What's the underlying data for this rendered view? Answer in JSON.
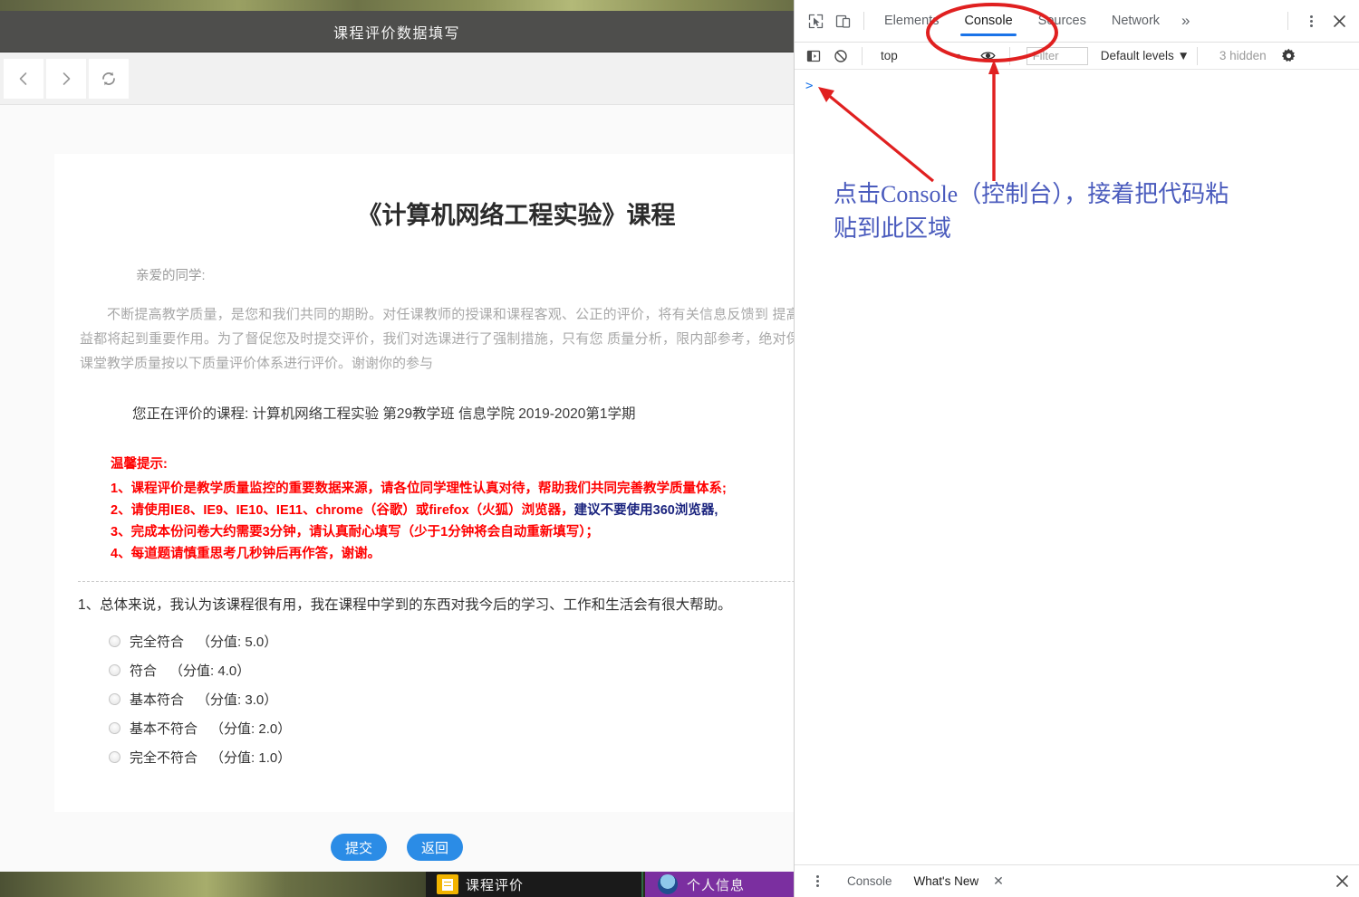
{
  "window": {
    "title": "课程评价数据填写",
    "nav": {
      "back": "back-arrow",
      "forward": "forward-arrow",
      "reload": "reload-arrow"
    }
  },
  "survey": {
    "doc_title": "《计算机网络工程实验》课程",
    "salutation": "亲爱的同学:",
    "intro": "不断提高教学质量，是您和我们共同的期盼。对任课教师的授课和课程客观、公正的评价，将有关信息反馈到 提高教学质量和维护您自身权益都将起到重要作用。为了督促您及时提交评价，我们对选课进行了强制措施，只有您 质量分析，限内部参考，绝对保密，请放心填写。请您给课堂教学质量按以下质量评价体系进行评价。谢谢你的参与",
    "course_line": "您正在评价的课程: 计算机网络工程实验  第29教学班  信息学院  2019-2020第1学期",
    "tips_title": "温馨提示:",
    "tips": [
      {
        "text": "1、课程评价是教学质量监控的重要数据来源，请各位同学理性认真对待，帮助我们共同完善教学质量体系;",
        "navy": ""
      },
      {
        "text": "2、请使用IE8、IE9、IE10、IE11、chrome（谷歌）或firefox（火狐）浏览器，",
        "navy": "建议不要使用360浏览器,"
      },
      {
        "text": "3、完成本份问卷大约需要3分钟，请认真耐心填写（少于1分钟将会自动重新填写）；",
        "navy": ""
      },
      {
        "text": "4、每道题请慎重思考几秒钟后再作答，谢谢。",
        "navy": ""
      }
    ],
    "question": "1、总体来说，我认为该课程很有用，我在课程中学到的东西对我今后的学习、工作和生活会有很大帮助。",
    "options": [
      {
        "label": "完全符合",
        "score": "（分值: 5.0）"
      },
      {
        "label": "符合",
        "score": "（分值: 4.0）"
      },
      {
        "label": "基本符合",
        "score": "（分值: 3.0）"
      },
      {
        "label": "基本不符合",
        "score": "（分值: 2.0）"
      },
      {
        "label": "完全不符合",
        "score": "（分值: 1.0）"
      }
    ],
    "buttons": {
      "submit": "提交",
      "back": "返回"
    }
  },
  "devtools": {
    "tabs": [
      {
        "label": "Elements",
        "active": false
      },
      {
        "label": "Console",
        "active": true
      },
      {
        "label": "Sources",
        "active": false
      },
      {
        "label": "Network",
        "active": false
      }
    ],
    "more_label": "»",
    "toolbar": {
      "context": "top",
      "filter_placeholder": "Filter",
      "filter_value": "",
      "levels": "Default levels ▼",
      "hidden_count": "3 hidden"
    },
    "console_prompt": ">",
    "drawer": {
      "tab_console": "Console",
      "tab_whats_new": "What's New",
      "close_label": "✕"
    },
    "accent_color": "#1a73e8"
  },
  "desktop": {
    "tile_courses": "课程评价",
    "tile_personal": "个人信息"
  },
  "annotation": {
    "text": "点击Console（控制台），接着把代码粘\n贴到此区域",
    "color": "#4a5bbd",
    "marker_color": "#e02020"
  }
}
